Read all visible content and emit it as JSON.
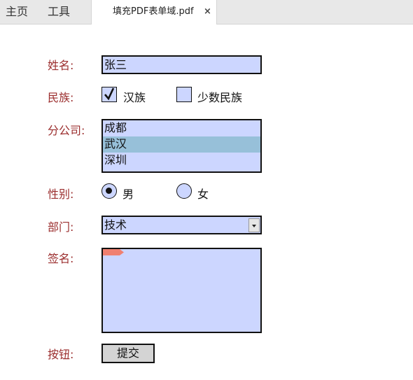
{
  "nav": {
    "home": "主页",
    "tools": "工具"
  },
  "tab": {
    "title": "填充PDF表单域.pdf",
    "close": "×"
  },
  "form": {
    "name": {
      "label": "姓名:",
      "value": "张三"
    },
    "ethnicity": {
      "label": "民族:",
      "options": [
        {
          "label": "汉族",
          "checked": true
        },
        {
          "label": "少数民族",
          "checked": false
        }
      ]
    },
    "branch": {
      "label": "分公司:",
      "items": [
        "成都",
        "武汉",
        "深圳"
      ],
      "selected": "武汉"
    },
    "gender": {
      "label": "性别:",
      "options": [
        {
          "label": "男",
          "selected": true
        },
        {
          "label": "女",
          "selected": false
        }
      ]
    },
    "department": {
      "label": "部门:",
      "value": "技术"
    },
    "signature": {
      "label": "签名:"
    },
    "button": {
      "label": "按钮:",
      "text": "提交"
    }
  },
  "colors": {
    "field_bg": "#ccd6ff",
    "label": "#9b2d2d",
    "list_selected": "#97c0d9"
  }
}
